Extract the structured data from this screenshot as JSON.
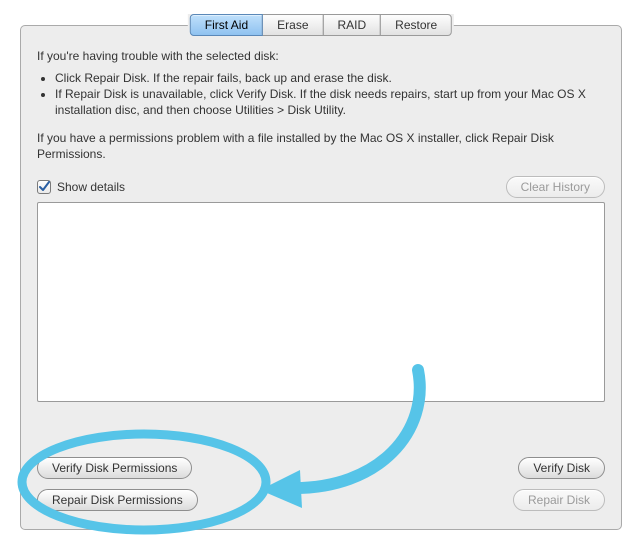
{
  "tabs": [
    {
      "label": "First Aid",
      "active": true
    },
    {
      "label": "Erase",
      "active": false
    },
    {
      "label": "RAID",
      "active": false
    },
    {
      "label": "Restore",
      "active": false
    }
  ],
  "intro": "If you're having trouble with the selected disk:",
  "bullets": [
    "Click Repair Disk. If the repair fails, back up and erase the disk.",
    "If Repair Disk is unavailable, click Verify Disk. If the disk needs repairs, start up from your Mac OS X installation disc, and then choose Utilities > Disk Utility."
  ],
  "perm_note": "If you have a permissions problem with a file installed by the Mac OS X installer, click Repair Disk Permissions.",
  "show_details": {
    "label": "Show details",
    "checked": true
  },
  "buttons": {
    "clear_history": "Clear History",
    "verify_perm": "Verify Disk Permissions",
    "repair_perm": "Repair Disk Permissions",
    "verify_disk": "Verify Disk",
    "repair_disk": "Repair Disk"
  },
  "annotation": {
    "color": "#56c4e8"
  }
}
